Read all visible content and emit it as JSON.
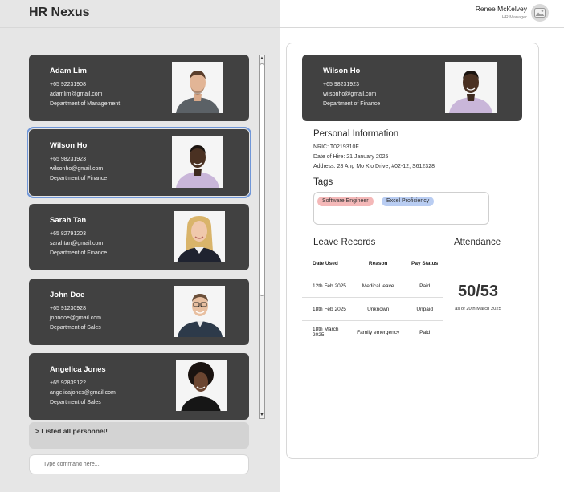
{
  "app": {
    "title": "HR Nexus"
  },
  "user": {
    "name": "Renee McKelvey",
    "role": "HR Manager"
  },
  "personnel": [
    {
      "name": "Adam Lim",
      "phone": "+65 92231908",
      "email": "adamlim@gmail.com",
      "department": "Department of Management"
    },
    {
      "name": "Wilson Ho",
      "phone": "+65 98231923",
      "email": "wilsonho@gmail.com",
      "department": "Department of Finance"
    },
    {
      "name": "Sarah Tan",
      "phone": "+65 82791203",
      "email": "sarahtan@gmail.com",
      "department": "Department of Finance"
    },
    {
      "name": "John Doe",
      "phone": "+65 91230928",
      "email": "johndoe@gmail.com",
      "department": "Department of Sales"
    },
    {
      "name": "Angelica Jones",
      "phone": "+65 92839122",
      "email": "angelicajones@gmail.com",
      "department": "Department of Sales"
    }
  ],
  "result": {
    "text": "> Listed all personnel!"
  },
  "command": {
    "placeholder": "Type command here..."
  },
  "detail": {
    "name": "Wilson Ho",
    "phone": "+65 98231923",
    "email": "wilsonho@gmail.com",
    "department": "Department of Finance",
    "personal_info_title": "Personal Information",
    "nric": "NRIC: T0219310F",
    "date_of_hire": "Date of Hire: 21 January 2025",
    "address": "Address: 28 Ang Mo Kio Drive, #02-12, S612328",
    "tags_title": "Tags",
    "tags": [
      {
        "label": "Software Engineer",
        "color": "#f4b8b8"
      },
      {
        "label": "Excel Proficiency",
        "color": "#b9cdf2"
      }
    ],
    "leave_title": "Leave Records",
    "leave_headers": [
      "Date Used",
      "Reason",
      "Pay Status"
    ],
    "leave_rows": [
      [
        "12th Feb 2025",
        "Medical leave",
        "Paid"
      ],
      [
        "18th Feb 2025",
        "Unknown",
        "Unpaid"
      ],
      [
        "18th March 2025",
        "Family emergency",
        "Paid"
      ]
    ],
    "attendance_title": "Attendance",
    "attendance_value": "50/53",
    "attendance_note": "as of 20th March 2025"
  },
  "colors": {
    "card": "#414141",
    "selected_outline": "#6f96d8",
    "tag_software": "#f4b8b8",
    "tag_excel": "#b9cdf2"
  }
}
